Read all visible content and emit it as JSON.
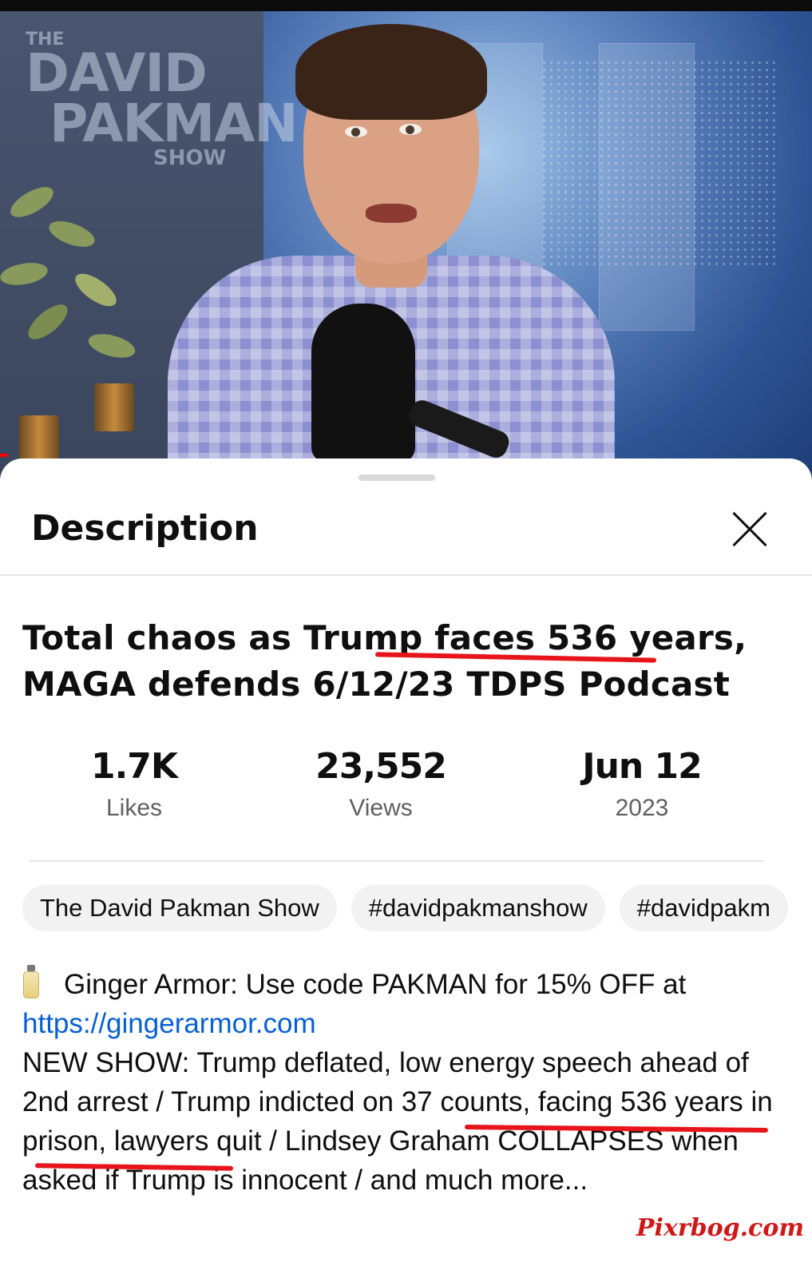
{
  "video": {
    "logo": {
      "the": "THE",
      "line1": "DAVID",
      "line2": "PAKMAN",
      "line3": "SHOW"
    }
  },
  "sheet": {
    "title": "Description",
    "video_title": "Total chaos as Trump faces 536 years, MAGA defends 6/12/23 TDPS Podcast",
    "stats": [
      {
        "value": "1.7K",
        "label": "Likes"
      },
      {
        "value": "23,552",
        "label": "Views"
      },
      {
        "value": "Jun 12",
        "label": "2023"
      }
    ],
    "chips": [
      "The David Pakman Show",
      "#davidpakmanshow",
      "#davidpakm"
    ],
    "description": {
      "sponsor_text": "Ginger Armor: Use code PAKMAN for 15% OFF at",
      "sponsor_link": "https://gingerarmor.com",
      "body": "NEW SHOW: Trump deflated, low energy speech ahead of 2nd arrest / Trump indicted on 37 counts, facing 536 years in prison, lawyers quit / Lindsey Graham COLLAPSES when asked if Trump is innocent / and much more..."
    }
  },
  "watermark": "Pixrbog.com",
  "colors": {
    "link": "#065fd4",
    "annotation_red": "#e8141b",
    "chip_bg": "#f2f2f2"
  }
}
